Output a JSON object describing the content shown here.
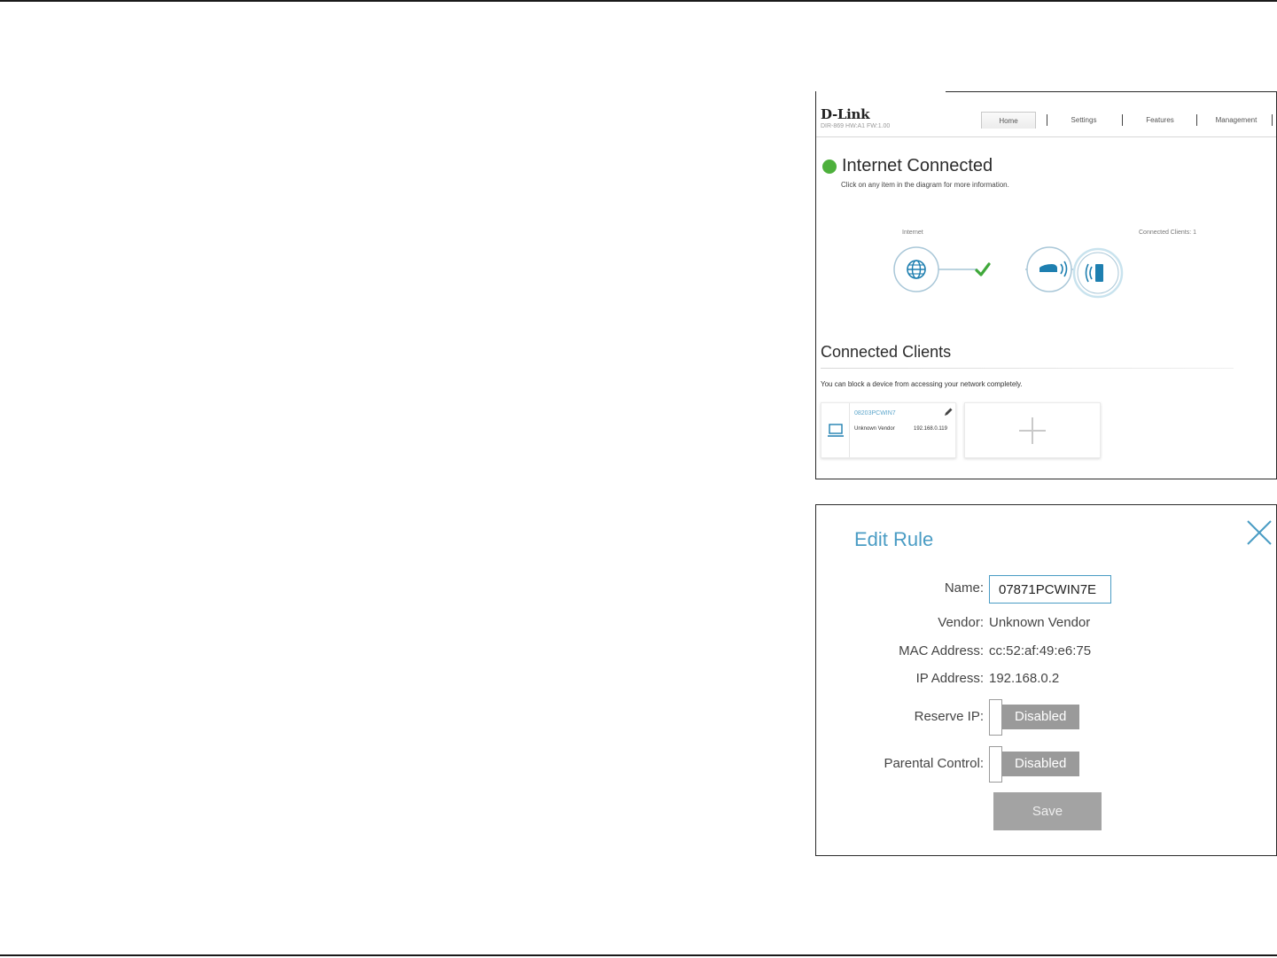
{
  "home": {
    "brand": "D-Link",
    "model": "DIR-869 HW:A1 FW:1.00",
    "nav": [
      "Home",
      "Settings",
      "Features",
      "Management"
    ],
    "status_title": "Internet Connected",
    "status_sub": "Click on any item in the diagram for more information.",
    "internet_label": "Internet",
    "clients_label": "Connected Clients: 1",
    "connected_clients_title": "Connected Clients",
    "connected_clients_desc": "You can block a device from accessing your network completely.",
    "client": {
      "name": "08203PCWIN7",
      "vendor": "Unknown Vendor",
      "ip": "192.168.0.119"
    },
    "colors": {
      "status_ok": "#4db03c",
      "accent": "#5fa7cc"
    },
    "icons": [
      "globe-icon",
      "check-icon",
      "router-icon",
      "wireless-client-icon",
      "laptop-icon",
      "pencil-icon",
      "plus-icon"
    ]
  },
  "edit_rule": {
    "title": "Edit Rule",
    "name_label": "Name:",
    "name_value": "07871PCWIN7E",
    "vendor_label": "Vendor:",
    "vendor_value": "Unknown Vendor",
    "mac_label": "MAC Address:",
    "mac_value": "cc:52:af:49:e6:75",
    "ip_label": "IP Address:",
    "ip_value": "192.168.0.2",
    "reserve_label": "Reserve IP:",
    "reserve_state": "Disabled",
    "parental_label": "Parental Control:",
    "parental_state": "Disabled",
    "save_label": "Save",
    "colors": {
      "accent": "#4a9cc4",
      "toggle_off": "#9a9a9a",
      "button": "#a3a3a3"
    }
  }
}
